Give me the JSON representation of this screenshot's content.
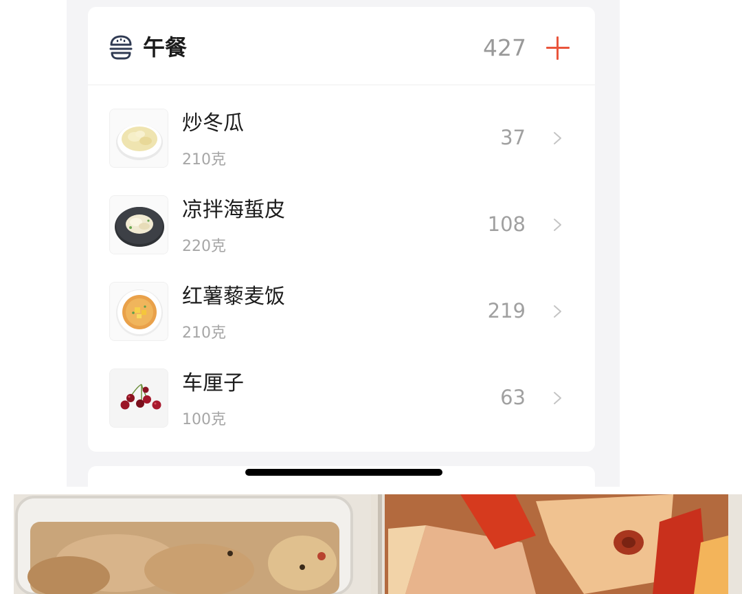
{
  "meal": {
    "title": "午餐",
    "total": "427",
    "icon": "burger-icon",
    "add_icon": "plus-icon",
    "accent_color": "#e9543b"
  },
  "foods": [
    {
      "name": "炒冬瓜",
      "weight": "210克",
      "kcal": "37",
      "thumb": "stir-fried-winter-melon"
    },
    {
      "name": "凉拌海蜇皮",
      "weight": "220克",
      "kcal": "108",
      "thumb": "jellyfish-salad"
    },
    {
      "name": "红薯藜麦饭",
      "weight": "210克",
      "kcal": "219",
      "thumb": "sweet-potato-quinoa-rice"
    },
    {
      "name": "车厘子",
      "weight": "100克",
      "kcal": "63",
      "thumb": "cherries"
    }
  ],
  "chevron_icon": "chevron-right-icon",
  "photo": "lunch-box-photo"
}
